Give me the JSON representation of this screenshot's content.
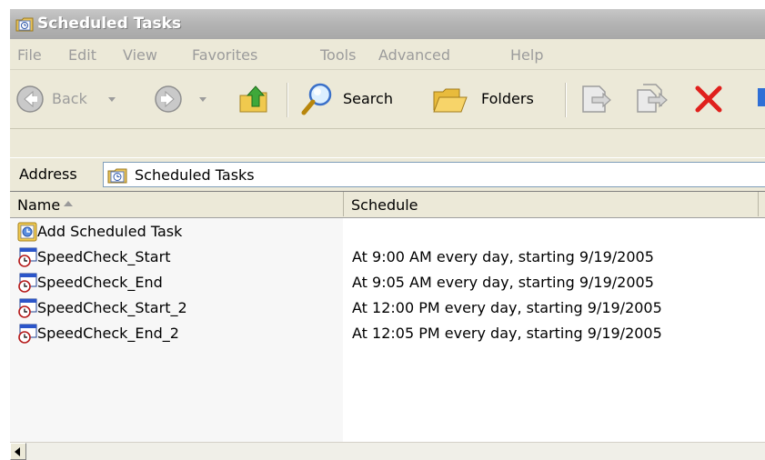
{
  "window": {
    "title": "Scheduled Tasks"
  },
  "menu": [
    "File",
    "Edit",
    "View",
    "Favorites",
    "Tools",
    "Advanced",
    "Help"
  ],
  "toolbar": {
    "back_label": "Back",
    "search_label": "Search",
    "folders_label": "Folders"
  },
  "address": {
    "label": "Address",
    "value": "Scheduled Tasks"
  },
  "columns": {
    "name": "Name",
    "schedule": "Schedule"
  },
  "rows": [
    {
      "name": "Add Scheduled Task",
      "schedule": "",
      "icon": "add-task-icon"
    },
    {
      "name": "SpeedCheck_Start",
      "schedule": "At 9:00 AM every day, starting 9/19/2005",
      "icon": "scheduled-task-icon"
    },
    {
      "name": "SpeedCheck_End",
      "schedule": "At 9:05 AM every day, starting 9/19/2005",
      "icon": "scheduled-task-icon"
    },
    {
      "name": "SpeedCheck_Start_2",
      "schedule": "At 12:00 PM every day, starting 9/19/2005",
      "icon": "scheduled-task-icon"
    },
    {
      "name": "SpeedCheck_End_2",
      "schedule": "At 12:05 PM every day, starting 9/19/2005",
      "icon": "scheduled-task-icon"
    }
  ],
  "colors": {
    "title_bar": "#b3b3b3",
    "window_face": "#ece9d8",
    "delete_red": "#e0201c"
  }
}
